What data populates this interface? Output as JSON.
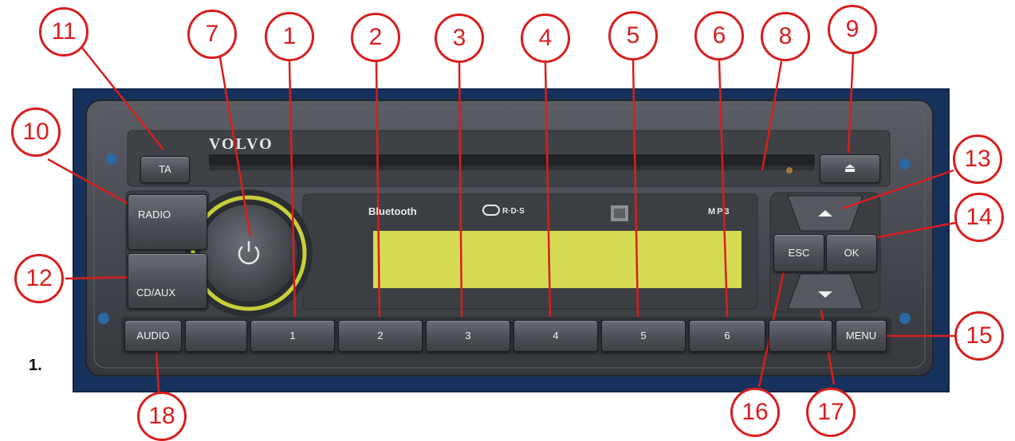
{
  "figure": {
    "label": "1."
  },
  "radio": {
    "brand": "VOLVO",
    "buttons": {
      "ta": "TA",
      "radio": "RADIO",
      "cdaux": "CD/AUX",
      "audio": "AUDIO",
      "menu": "MENU",
      "esc": "ESC",
      "ok": "OK",
      "presets": [
        "1",
        "2",
        "3",
        "4",
        "5",
        "6"
      ]
    },
    "display_icons": {
      "bluetooth": "Bluetooth",
      "rds": "R·D·S",
      "mp3": "MP3"
    }
  },
  "callouts": [
    "1",
    "2",
    "3",
    "4",
    "5",
    "6",
    "7",
    "8",
    "9",
    "10",
    "11",
    "12",
    "13",
    "14",
    "15",
    "16",
    "17",
    "18"
  ],
  "colors": {
    "callout": "#d81e1e",
    "background_panel": "#16325c",
    "faceplate": "#474b51",
    "lcd": "#d6dc52"
  }
}
